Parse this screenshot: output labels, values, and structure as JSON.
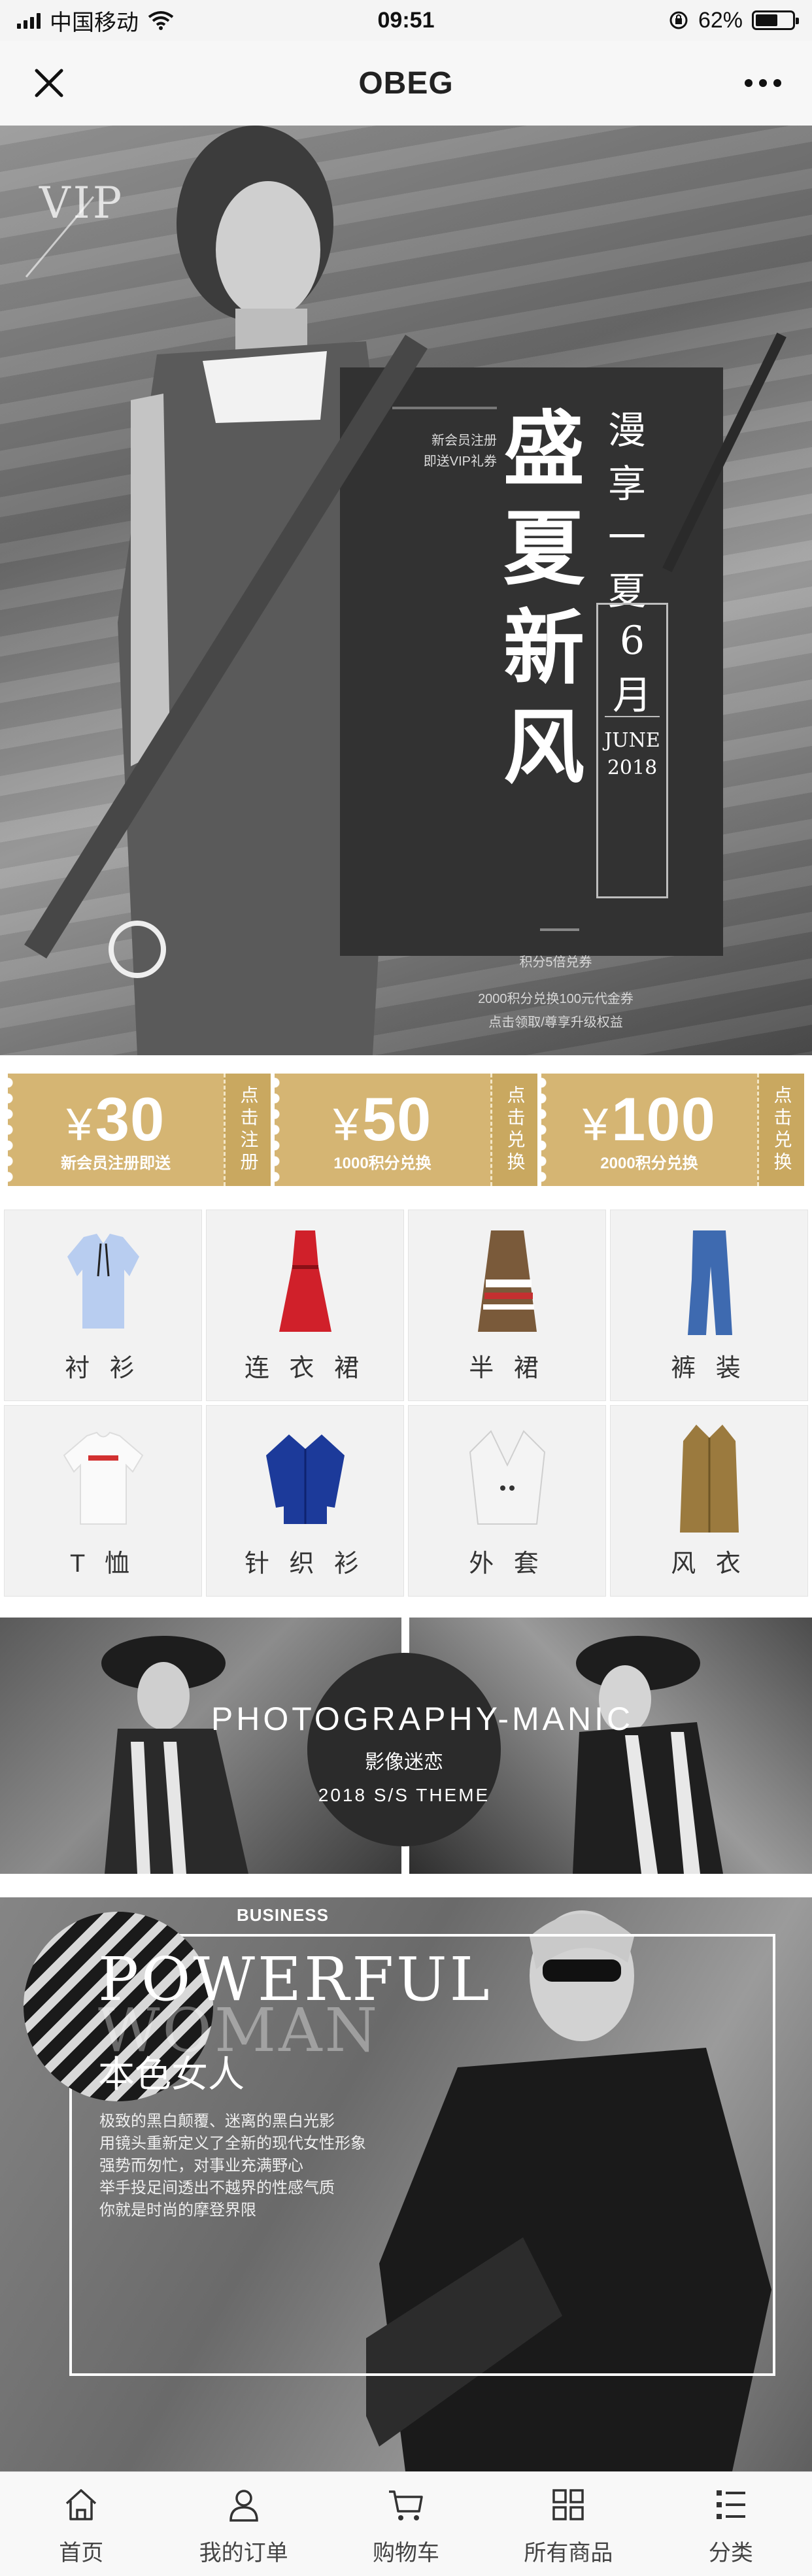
{
  "status_bar": {
    "carrier": "中国移动",
    "time": "09:51",
    "battery": "62%",
    "battery_level": 0.62
  },
  "nav": {
    "title": "OBEG"
  },
  "hero": {
    "watermark": "VIP",
    "member_note": [
      "新会员注册",
      "即送VIP礼券"
    ],
    "title_chars": [
      "盛",
      "夏",
      "新",
      "风"
    ],
    "subtitle_chars": [
      "漫",
      "享",
      "一",
      "夏"
    ],
    "month_number": "6",
    "month_char": "月",
    "month_name": "JUNE",
    "year": "2018",
    "line1": "积分5倍兑券",
    "line2": "2000积分兑换100元代金券",
    "line3": "点击领取/尊享升级权益",
    "slides": 4,
    "active_slide": 1
  },
  "coupons": [
    {
      "currency": "¥",
      "amount": "30",
      "desc": "新会员注册即送",
      "action": "点击注册"
    },
    {
      "currency": "¥",
      "amount": "50",
      "desc": "1000积分兑换",
      "action": "点击兑换"
    },
    {
      "currency": "¥",
      "amount": "100",
      "desc": "2000积分兑换",
      "action": "点击兑换"
    }
  ],
  "categories": [
    {
      "label": "衬 衫",
      "icon": "shirt-icon"
    },
    {
      "label": "连 衣 裙",
      "icon": "dress-icon"
    },
    {
      "label": "半 裙",
      "icon": "skirt-icon"
    },
    {
      "label": "裤 装",
      "icon": "jeans-icon"
    },
    {
      "label": "T 恤",
      "icon": "tshirt-icon"
    },
    {
      "label": "针 织 衫",
      "icon": "cardigan-icon"
    },
    {
      "label": "外 套",
      "icon": "jacket-icon"
    },
    {
      "label": "风 衣",
      "icon": "trench-coat-icon"
    }
  ],
  "photo_banner": {
    "title": "PHOTOGRAPHY-MANIC",
    "subtitle": "影像迷恋",
    "theme": "2018 S/S THEME"
  },
  "woman_banner": {
    "tag": "BUSINESS",
    "title1": "POWERFUL",
    "title2": "WOMAN",
    "title_cn": "本色女人",
    "desc": [
      "极致的黑白颠覆、迷离的黑白光影",
      "用镜头重新定义了全新的现代女性形象",
      "强势而匆忙，对事业充满野心",
      "举手投足间透出不越界的性感气质",
      "你就是时尚的摩登界限"
    ]
  },
  "tabs": [
    {
      "label": "首页",
      "icon": "home-icon"
    },
    {
      "label": "我的订单",
      "icon": "user-icon"
    },
    {
      "label": "购物车",
      "icon": "cart-icon"
    },
    {
      "label": "所有商品",
      "icon": "grid-icon"
    },
    {
      "label": "分类",
      "icon": "list-icon"
    }
  ],
  "colors": {
    "coupon_gold": "#d5b573",
    "coupon_gold_dark": "#c9a860",
    "active_dot": "#1f7cff",
    "promo_card": "#323232"
  }
}
